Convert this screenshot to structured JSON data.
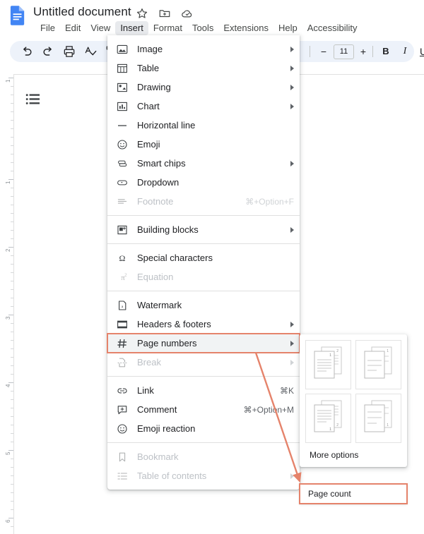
{
  "app": {
    "name": "Google Docs",
    "accent_blue": "#4285f4",
    "highlight_color": "#e5836b",
    "toolbar_bg": "#edf2fa"
  },
  "titlebar": {
    "doc_title": "Untitled document",
    "icons": [
      {
        "name": "star-icon",
        "label": "Star"
      },
      {
        "name": "move-to-folder-icon",
        "label": "Move"
      },
      {
        "name": "cloud-saved-icon",
        "label": "Saved to Drive"
      }
    ]
  },
  "menubar": {
    "items": [
      {
        "label": "File",
        "active": false
      },
      {
        "label": "Edit",
        "active": false
      },
      {
        "label": "View",
        "active": false
      },
      {
        "label": "Insert",
        "active": true
      },
      {
        "label": "Format",
        "active": false
      },
      {
        "label": "Tools",
        "active": false
      },
      {
        "label": "Extensions",
        "active": false
      },
      {
        "label": "Help",
        "active": false
      },
      {
        "label": "Accessibility",
        "active": false
      }
    ]
  },
  "toolbar": {
    "undo": "Undo",
    "redo": "Redo",
    "print": "Print",
    "spellcheck": "Spelling and grammar check",
    "paint_format": "Paint format",
    "zoom_minus": "−",
    "font_size": "11",
    "zoom_plus": "+",
    "bold": "B",
    "italic": "I",
    "underline": "U"
  },
  "ruler": {
    "labels": [
      "1",
      "1",
      "2",
      "3",
      "4",
      "5",
      "6"
    ]
  },
  "document": {
    "bullet_list_icon": "bulleted-list-icon"
  },
  "insert_menu": {
    "groups": [
      {
        "items": [
          {
            "label": "Image",
            "icon": "image-icon",
            "submenu": true,
            "disabled": false,
            "accel": ""
          },
          {
            "label": "Table",
            "icon": "table-icon",
            "submenu": true,
            "disabled": false,
            "accel": ""
          },
          {
            "label": "Drawing",
            "icon": "drawing-icon",
            "submenu": true,
            "disabled": false,
            "accel": ""
          },
          {
            "label": "Chart",
            "icon": "chart-icon",
            "submenu": true,
            "disabled": false,
            "accel": ""
          },
          {
            "label": "Horizontal line",
            "icon": "horizontal-line-icon",
            "submenu": false,
            "disabled": false,
            "accel": ""
          },
          {
            "label": "Emoji",
            "icon": "emoji-icon",
            "submenu": false,
            "disabled": false,
            "accel": ""
          },
          {
            "label": "Smart chips",
            "icon": "smart-chips-icon",
            "submenu": true,
            "disabled": false,
            "accel": ""
          },
          {
            "label": "Dropdown",
            "icon": "dropdown-icon",
            "submenu": false,
            "disabled": false,
            "accel": ""
          },
          {
            "label": "Footnote",
            "icon": "footnote-icon",
            "submenu": false,
            "disabled": true,
            "accel": "⌘+Option+F"
          }
        ]
      },
      {
        "items": [
          {
            "label": "Building blocks",
            "icon": "building-blocks-icon",
            "submenu": true,
            "disabled": false,
            "accel": ""
          }
        ]
      },
      {
        "items": [
          {
            "label": "Special characters",
            "icon": "special-characters-icon",
            "submenu": false,
            "disabled": false,
            "accel": ""
          },
          {
            "label": "Equation",
            "icon": "equation-icon",
            "submenu": false,
            "disabled": true,
            "accel": ""
          }
        ]
      },
      {
        "items": [
          {
            "label": "Watermark",
            "icon": "watermark-icon",
            "submenu": false,
            "disabled": false,
            "accel": ""
          },
          {
            "label": "Headers & footers",
            "icon": "headers-footers-icon",
            "submenu": true,
            "disabled": false,
            "accel": ""
          },
          {
            "label": "Page numbers",
            "icon": "page-numbers-icon",
            "submenu": true,
            "disabled": false,
            "accel": "",
            "highlighted": true
          },
          {
            "label": "Break",
            "icon": "break-icon",
            "submenu": true,
            "disabled": true,
            "accel": ""
          }
        ]
      },
      {
        "items": [
          {
            "label": "Link",
            "icon": "link-icon",
            "submenu": false,
            "disabled": false,
            "accel": "⌘K"
          },
          {
            "label": "Comment",
            "icon": "comment-icon",
            "submenu": false,
            "disabled": false,
            "accel": "⌘+Option+M"
          },
          {
            "label": "Emoji reaction",
            "icon": "emoji-reaction-icon",
            "submenu": false,
            "disabled": false,
            "accel": ""
          }
        ]
      },
      {
        "items": [
          {
            "label": "Bookmark",
            "icon": "bookmark-icon",
            "submenu": false,
            "disabled": true,
            "accel": ""
          },
          {
            "label": "Table of contents",
            "icon": "table-of-contents-icon",
            "submenu": true,
            "disabled": true,
            "accel": ""
          }
        ]
      }
    ]
  },
  "page_numbers_submenu": {
    "thumbnails": [
      {
        "name": "page-number-top-right-all-pages",
        "position": "top-right",
        "two_pages": true,
        "numbers": [
          "1",
          "2"
        ]
      },
      {
        "name": "page-number-top-right-skip-first",
        "position": "top-right",
        "two_pages": true,
        "numbers": [
          "1"
        ]
      },
      {
        "name": "page-number-bottom-right-all-pages",
        "position": "bottom-right",
        "two_pages": true,
        "numbers": [
          "1",
          "2"
        ]
      },
      {
        "name": "page-number-bottom-right-skip-first",
        "position": "bottom-right",
        "two_pages": true,
        "numbers": [
          "1"
        ]
      }
    ],
    "more_options": "More options",
    "page_count": "Page count"
  }
}
